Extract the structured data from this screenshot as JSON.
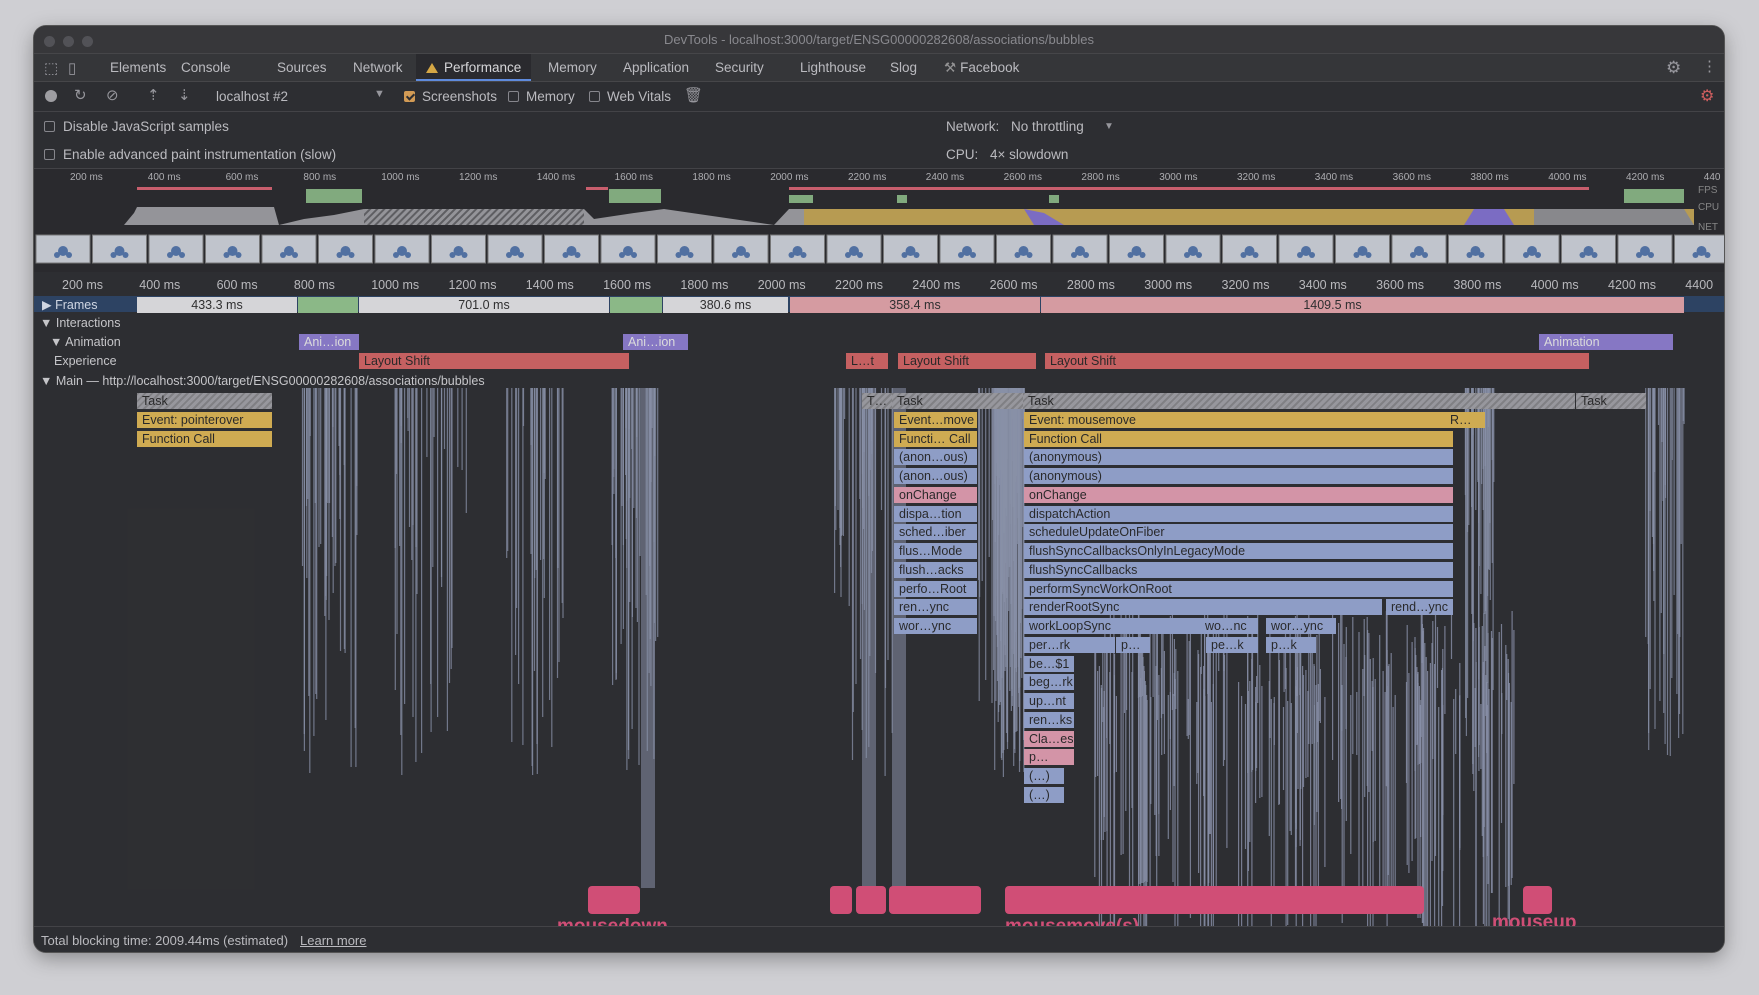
{
  "window": {
    "title": "DevTools - localhost:3000/target/ENSG00000282608/associations/bubbles"
  },
  "tabs": [
    {
      "label": "Elements"
    },
    {
      "label": "Console"
    },
    {
      "label": "Sources"
    },
    {
      "label": "Network"
    },
    {
      "label": "Performance",
      "active": true,
      "warning": true
    },
    {
      "label": "Memory"
    },
    {
      "label": "Application"
    },
    {
      "label": "Security"
    },
    {
      "label": "Lighthouse"
    },
    {
      "label": "Slog"
    },
    {
      "label": "Facebook"
    }
  ],
  "toolbar": {
    "target_select": "localhost #2",
    "screenshots_label": "Screenshots",
    "screenshots_checked": true,
    "memory_label": "Memory",
    "memory_checked": false,
    "web_vitals_label": "Web Vitals",
    "web_vitals_checked": false
  },
  "settings": {
    "disable_js_samples": "Disable JavaScript samples",
    "advanced_paint": "Enable advanced paint instrumentation (slow)",
    "network_label": "Network:",
    "network_value": "No throttling",
    "cpu_label": "CPU:",
    "cpu_value": "4× slowdown"
  },
  "overview": {
    "ticks": [
      "200 ms",
      "400 ms",
      "600 ms",
      "800 ms",
      "1000 ms",
      "1200 ms",
      "1400 ms",
      "1600 ms",
      "1800 ms",
      "2000 ms",
      "2200 ms",
      "2400 ms",
      "2600 ms",
      "2800 ms",
      "3000 ms",
      "3200 ms",
      "3400 ms",
      "3600 ms",
      "3800 ms",
      "4000 ms",
      "4200 ms",
      "440"
    ],
    "fps_label": "FPS",
    "cpu_label": "CPU",
    "net_label": "NET"
  },
  "timeline": {
    "ticks": [
      "200 ms",
      "400 ms",
      "600 ms",
      "800 ms",
      "1000 ms",
      "1200 ms",
      "1400 ms",
      "1600 ms",
      "1800 ms",
      "2000 ms",
      "2200 ms",
      "2400 ms",
      "2600 ms",
      "2800 ms",
      "3000 ms",
      "3200 ms",
      "3400 ms",
      "3600 ms",
      "3800 ms",
      "4000 ms",
      "4200 ms",
      "4400"
    ],
    "tracks": {
      "frames": "Frames",
      "interactions": "Interactions",
      "animation": "Animation",
      "experience": "Experience",
      "main": "Main — http://localhost:3000/target/ENSG00000282608/associations/bubbles"
    },
    "frames": [
      "433.3 ms",
      "701.0 ms",
      "380.6 ms",
      "358.4 ms",
      "1409.5 ms"
    ],
    "anim": [
      "Ani…ion",
      "Ani…ion",
      "Animation"
    ],
    "experience": [
      "Layout Shift",
      "L…t",
      "Layout Shift",
      "Layout Shift"
    ],
    "flame_left": [
      "Task",
      "Event: pointerover",
      "Function Call"
    ],
    "flame_mid": [
      "T…",
      "Task",
      "Event…move",
      "Functi… Call",
      "(anon…ous)",
      "(anon…ous)",
      "onChange",
      "dispa…tion",
      "sched…iber",
      "flus…Mode",
      "flush…acks",
      "perfo…Root",
      "ren…ync",
      "wor…ync"
    ],
    "flame_big": [
      "Task",
      "Event: mousemove",
      "Function Call",
      "(anonymous)",
      "(anonymous)",
      "onChange",
      "dispatchAction",
      "scheduleUpdateOnFiber",
      "flushSyncCallbacksOnlyInLegacyMode",
      "flushSyncCallbacks",
      "performSyncWorkOnRoot",
      "renderRootSync",
      "workLoopSync",
      "per…rk",
      "be…$1",
      "beg…rk",
      "up…nt",
      "ren…ks",
      "Cla…es",
      "p…",
      "(…)",
      "(…)"
    ],
    "flame_big_extra": [
      "rend…ync",
      "wo…nc",
      "wor…ync",
      "p…",
      "pe…k",
      "p…k"
    ],
    "flame_right": [
      "R…",
      "Task"
    ]
  },
  "annotations": {
    "mousedown": "mousedown",
    "mousemove": "mousemove(s)",
    "mouseup": "mouseup"
  },
  "status": {
    "text": "Total blocking time: 2009.44ms (estimated)",
    "link": "Learn more"
  }
}
